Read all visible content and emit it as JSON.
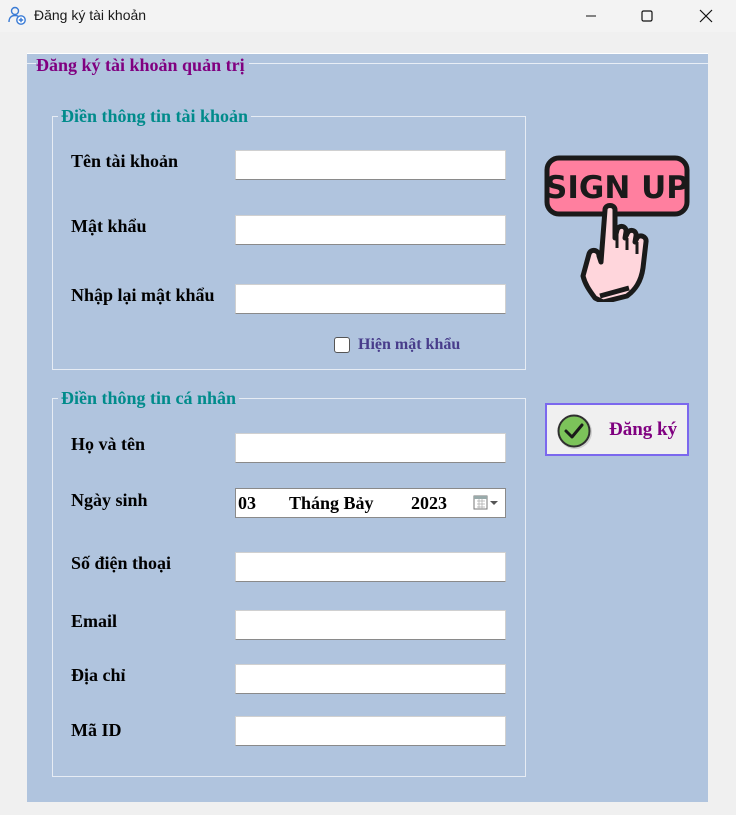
{
  "window": {
    "title": "Đăng ký tài khoản",
    "minimize_glyph": "—",
    "maximize_glyph": "☐",
    "close_glyph": "✕"
  },
  "form": {
    "title": "Đăng ký tài khoản quản trị",
    "account_group": {
      "legend": "Điền thông tin tài khoản",
      "username_label": "Tên tài khoản",
      "username_value": "",
      "password_label": "Mật khẩu",
      "password_value": "",
      "confirm_password_label": "Nhập lại mật khẩu",
      "confirm_password_value": "",
      "show_password_label": "Hiện mật khẩu",
      "show_password_checked": false
    },
    "personal_group": {
      "legend": "Điền thông tin cá nhân",
      "fullname_label": "Họ và tên",
      "fullname_value": "",
      "birthdate_label": "Ngày sinh",
      "birthdate_day": "03",
      "birthdate_month": "Tháng Bảy",
      "birthdate_year": "2023",
      "phone_label": "Số điện thoại",
      "phone_value": "",
      "email_label": "Email",
      "email_value": "",
      "address_label": "Địa chỉ",
      "address_value": "",
      "id_label": "Mã ID",
      "id_value": ""
    },
    "signup_image_text": "SIGN UP",
    "register_button": "Đăng ký"
  },
  "colors": {
    "panel_bg": "#b0c4de",
    "title_color": "#800080",
    "legend_color": "#008b8b",
    "checkbox_label_color": "#483d8b",
    "signup_pink": "#ff7f9f",
    "check_green": "#7cc35a"
  },
  "icons": {
    "app": "user-add-icon",
    "calendar": "calendar-dropdown-icon",
    "register": "check-circle-icon",
    "signup": "sign-up-hand-icon"
  }
}
